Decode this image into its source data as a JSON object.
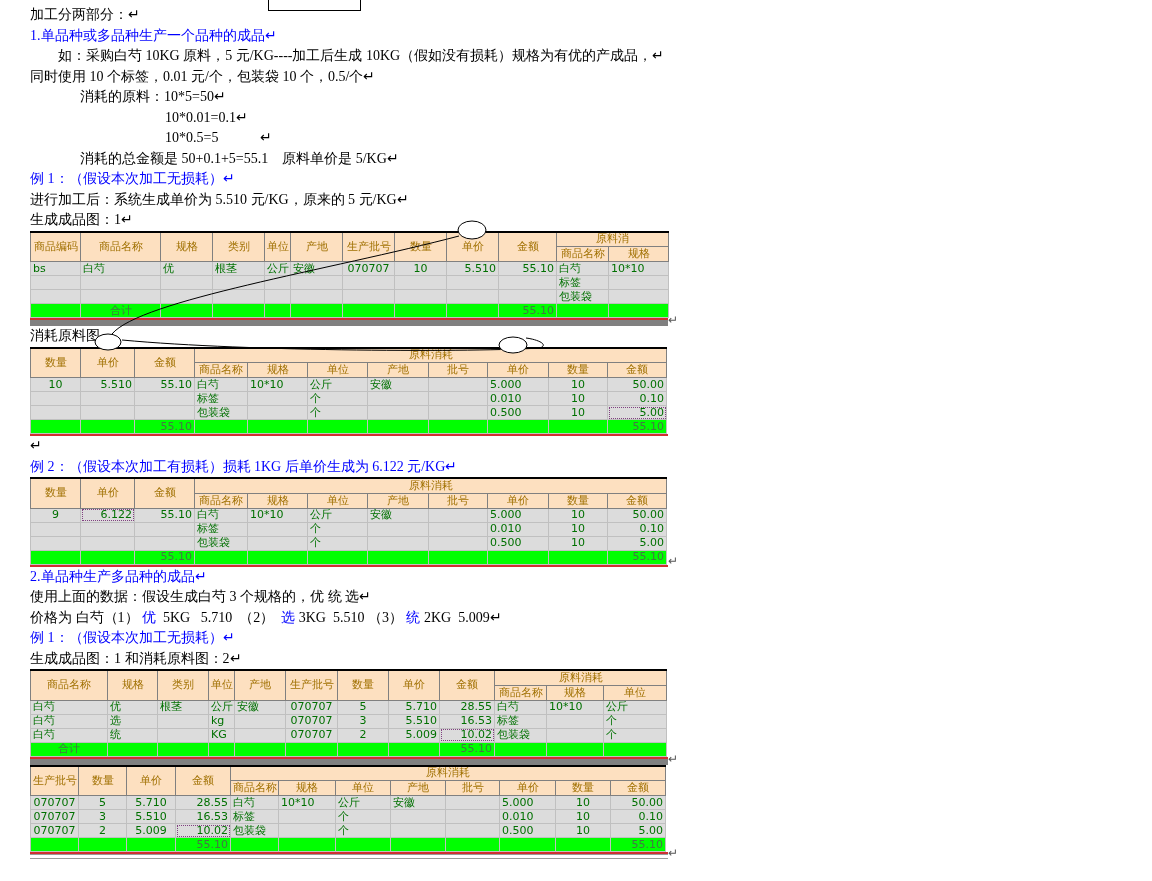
{
  "blocks": [
    {
      "kind": "body",
      "text": "加工分两部分：↵"
    },
    {
      "kind": "heading",
      "text": "1.单品种或多品种生产一个品种的成品↵"
    },
    {
      "kind": "indent",
      "text": "如：采购白芍 10KG 原料，5 元/KG----加工后生成 10KG（假如没有损耗）规格为有优的产成品，↵"
    },
    {
      "kind": "body",
      "text": "同时使用 10 个标签，0.01 元/个，包装袋 10 个，0.5/个↵"
    },
    {
      "kind": "indent2",
      "text": "消耗的原料：10*5=50↵"
    },
    {
      "kind": "formula",
      "text": "10*0.01=0.1↵"
    },
    {
      "kind": "formula",
      "text": "10*0.5=5　　　↵"
    },
    {
      "kind": "indent2",
      "text": "消耗的总金额是 50+0.1+5=55.1　原料单价是 5/KG↵"
    },
    {
      "kind": "heading",
      "text": "例 1：（假设本次加工无损耗）↵"
    },
    {
      "kind": "body",
      "text": "进行加工后：系统生成单价为 5.510 元/KG，原来的 5 元/KG↵"
    },
    {
      "kind": "body",
      "text": "生成成品图：1↵"
    },
    {
      "kind": "table",
      "end_mark": "↵",
      "left_columns": [
        "商品编码",
        "商品名称",
        "规格",
        "类别",
        "单位",
        "产地",
        "生产批号",
        "数量",
        "单价",
        "金额"
      ],
      "group_header": "原料消",
      "sub_columns": [
        "商品名称",
        "规格"
      ],
      "rows": [
        {
          "product_code": "bs",
          "product_name": "白芍",
          "spec": "优",
          "category": "根茎",
          "unit": "公斤",
          "origin": "安徽",
          "batch_no": "070707",
          "quantity": "10",
          "unit_price": "5.510",
          "amount": "55.10",
          "material_name": "白芍",
          "material_spec": "10*10"
        },
        {
          "material_name": "标签"
        },
        {
          "material_name": "包装袋"
        }
      ],
      "total": {
        "product_name": "合计",
        "amount": "55.10"
      }
    },
    {
      "kind": "body",
      "text": "消耗原料图"
    },
    {
      "kind": "table",
      "left_columns": [
        "数量",
        "单价",
        "金额"
      ],
      "group_header": "原料消耗",
      "sub_columns": [
        "商品名称",
        "规格",
        "单位",
        "产地",
        "批号",
        "单价",
        "数量",
        "金额"
      ],
      "rows": [
        {
          "quantity": "10",
          "unit_price": "5.510",
          "amount": "55.10",
          "material_name": "白芍",
          "material_spec": "10*10",
          "material_unit": "公斤",
          "material_origin": "安徽",
          "material_unit_price": "5.000",
          "material_quantity": "10",
          "material_amount": "50.00"
        },
        {
          "material_name": "标签",
          "material_unit": "个",
          "material_unit_price": "0.010",
          "material_quantity": "10",
          "material_amount": "0.10"
        },
        {
          "material_name": "包装袋",
          "material_unit": "个",
          "material_unit_price": "0.500",
          "material_quantity": "10",
          "material_amount": {
            "text": "5.00",
            "selected": true
          }
        }
      ],
      "total": {
        "amount": "55.10",
        "material_amount": "55.10"
      }
    },
    {
      "kind": "body",
      "text": "↵"
    },
    {
      "kind": "heading",
      "text": "例 2：（假设本次加工有损耗）损耗 1KG 后单价生成为 6.122 元/KG↵"
    },
    {
      "kind": "table",
      "end_mark": "↵",
      "left_columns": [
        "数量",
        "单价",
        "金额"
      ],
      "group_header": "原料消耗",
      "sub_columns": [
        "商品名称",
        "规格",
        "单位",
        "产地",
        "批号",
        "单价",
        "数量",
        "金额"
      ],
      "rows": [
        {
          "quantity": "9",
          "unit_price": {
            "text": "6.122",
            "selected": true
          },
          "amount": "55.10",
          "material_name": "白芍",
          "material_spec": "10*10",
          "material_unit": "公斤",
          "material_origin": "安徽",
          "material_unit_price": "5.000",
          "material_quantity": "10",
          "material_amount": "50.00"
        },
        {
          "material_name": "标签",
          "material_unit": "个",
          "material_unit_price": "0.010",
          "material_quantity": "10",
          "material_amount": "0.10"
        },
        {
          "material_name": "包装袋",
          "material_unit": "个",
          "material_unit_price": "0.500",
          "material_quantity": "10",
          "material_amount": "5.00"
        }
      ],
      "total": {
        "amount": "55.10",
        "material_amount": "55.10"
      }
    },
    {
      "kind": "heading",
      "text": "2.单品种生产多品种的成品↵"
    },
    {
      "kind": "body",
      "text": "使用上面的数据：假设生成白芍 3 个规格的，优 统 选↵"
    },
    {
      "kind": "body",
      "segments": [
        {
          "text": "价格为 白芍（1） ",
          "blue": false
        },
        {
          "text": "优",
          "blue": true
        },
        {
          "text": "  5KG   5.710  （2）  ",
          "blue": false
        },
        {
          "text": "选",
          "blue": true
        },
        {
          "text": " 3KG  5.510 （3） ",
          "blue": false
        },
        {
          "text": "统",
          "blue": true
        },
        {
          "text": " 2KG  5.009↵",
          "blue": false
        }
      ]
    },
    {
      "kind": "heading",
      "text": "例 1：（假设本次加工无损耗）↵"
    },
    {
      "kind": "body",
      "text": "生成成品图：1 和消耗原料图：2↵"
    },
    {
      "kind": "table",
      "end_mark": "↵",
      "left_columns": [
        "商品名称",
        "规格",
        "类别",
        "单位",
        "产地",
        "生产批号",
        "数量",
        "单价",
        "金额"
      ],
      "group_header": "原料消耗",
      "sub_columns": [
        "商品名称",
        "规格",
        "单位"
      ],
      "rows": [
        {
          "product_name": "白芍",
          "spec": "优",
          "category": "根茎",
          "unit": "公斤",
          "origin": "安徽",
          "batch_no": "070707",
          "quantity": "5",
          "unit_price": "5.710",
          "amount": "28.55",
          "material_name": "白芍",
          "material_spec": "10*10",
          "material_unit": "公斤"
        },
        {
          "product_name": "白芍",
          "spec": "选",
          "unit": "kg",
          "batch_no": "070707",
          "quantity": "3",
          "unit_price": "5.510",
          "amount": "16.53",
          "material_name": "标签",
          "material_unit": "个"
        },
        {
          "product_name": "白芍",
          "spec": "统",
          "unit": "KG",
          "batch_no": "070707",
          "quantity": "2",
          "unit_price": "5.009",
          "amount": {
            "text": "10.02",
            "selected": true
          },
          "material_name": "包装袋",
          "material_unit": "个"
        }
      ],
      "total": {
        "product_name": "合计",
        "amount": "55.10"
      }
    },
    {
      "kind": "table",
      "end_mark": "↵",
      "left_columns": [
        "生产批号",
        "数量",
        "单价",
        "金额"
      ],
      "group_header": "原料消耗",
      "sub_columns": [
        "商品名称",
        "规格",
        "单位",
        "产地",
        "批号",
        "单价",
        "数量",
        "金额"
      ],
      "rows": [
        {
          "batch_no": "070707",
          "quantity": "5",
          "unit_price": "5.710",
          "amount": "28.55",
          "material_name": "白芍",
          "material_spec": "10*10",
          "material_unit": "公斤",
          "material_origin": "安徽",
          "material_unit_price": "5.000",
          "material_quantity": "10",
          "material_amount": "50.00"
        },
        {
          "batch_no": "070707",
          "quantity": "3",
          "unit_price": "5.510",
          "amount": "16.53",
          "material_name": "标签",
          "material_unit": "个",
          "material_unit_price": "0.010",
          "material_quantity": "10",
          "material_amount": "0.10"
        },
        {
          "batch_no": "070707",
          "quantity": "2",
          "unit_price": "5.009",
          "amount": {
            "text": "10.02",
            "selected": true
          },
          "material_name": "包装袋",
          "material_unit": "个",
          "material_unit_price": "0.500",
          "material_quantity": "10",
          "material_amount": "5.00"
        }
      ],
      "total": {
        "amount": "55.10",
        "material_amount": "55.10"
      }
    }
  ]
}
